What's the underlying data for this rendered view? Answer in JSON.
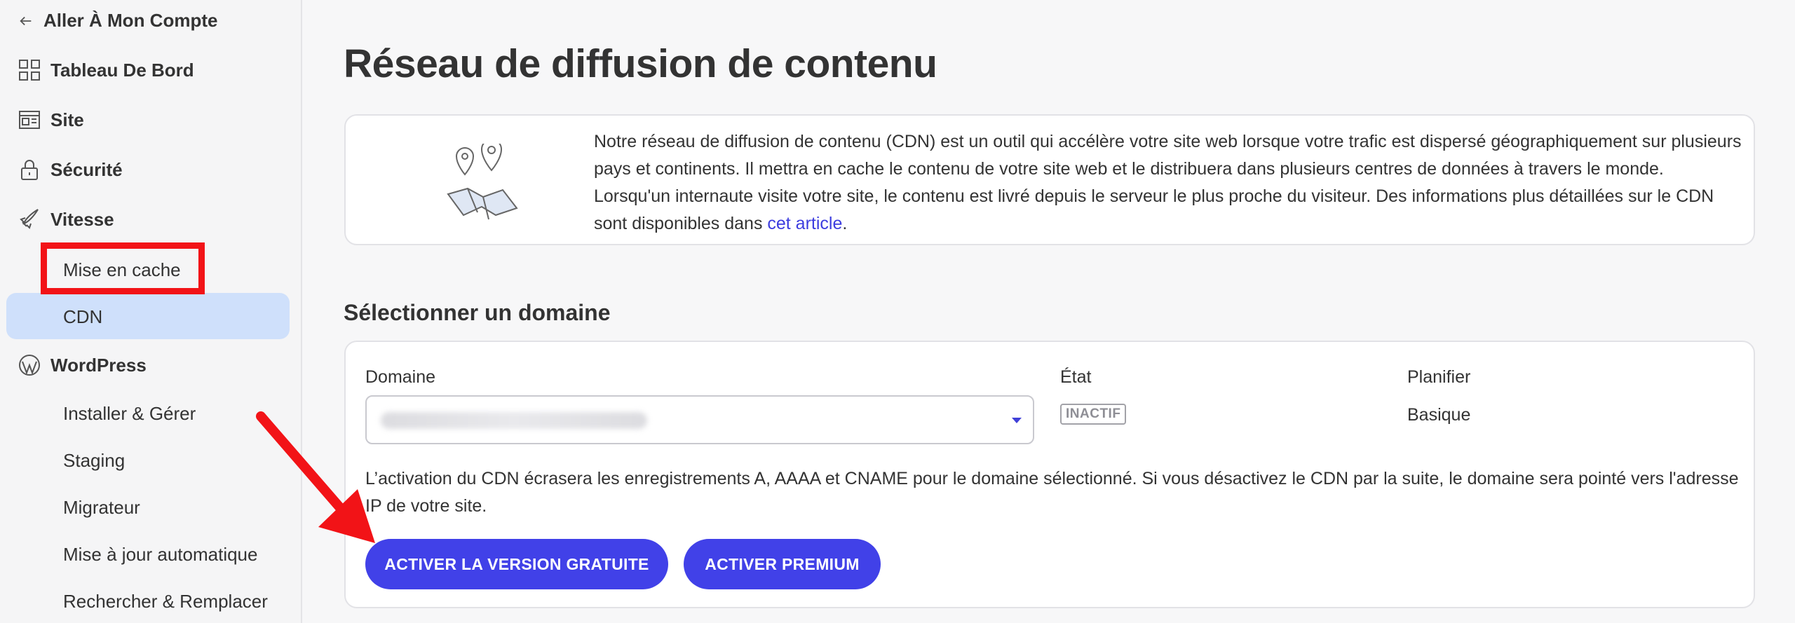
{
  "sidebar": {
    "back_label": "Aller À Mon Compte",
    "items": [
      {
        "label": "Tableau De Bord",
        "icon": "grid-icon"
      },
      {
        "label": "Site",
        "icon": "site-icon"
      },
      {
        "label": "Sécurité",
        "icon": "lock-icon"
      },
      {
        "label": "Vitesse",
        "icon": "rocket-icon"
      },
      {
        "label": "WordPress",
        "icon": "wordpress-icon"
      }
    ],
    "speed_sub": [
      "Mise en cache",
      "CDN"
    ],
    "wordpress_sub": [
      "Installer & Gérer",
      "Staging",
      "Migrateur",
      "Mise à jour automatique",
      "Rechercher & Remplacer"
    ],
    "active_item": "CDN"
  },
  "page": {
    "title": "Réseau de diffusion de contenu"
  },
  "info": {
    "text": "Notre réseau de diffusion de contenu (CDN) est un outil qui accélère votre site web lorsque votre trafic est dispersé géographiquement sur plusieurs pays et continents. Il mettra en cache le contenu de votre site web et le distribuera dans plusieurs centres de données à travers le monde. Lorsqu'un internaute visite votre site, le contenu est livré depuis le serveur le plus proche du visiteur. Des informations plus détaillées sur le CDN sont disponibles dans ",
    "link": "cet article",
    "after": ".",
    "illustration": "map-pins-icon"
  },
  "domain_section": {
    "title": "Sélectionner un domaine",
    "col_domain": "Domaine",
    "col_state": "État",
    "col_plan": "Planifier",
    "state_value": "INACTIF",
    "plan_value": "Basique",
    "warning": "L’activation du CDN écrasera les enregistrements A, AAAA et CNAME pour le domaine sélectionné. Si vous désactivez le CDN par la suite, le domaine sera pointé vers l'adresse IP de votre site.",
    "btn_free": "ACTIVER LA VERSION GRATUITE",
    "btn_premium": "ACTIVER PREMIUM"
  },
  "colors": {
    "accent": "#4141e8",
    "active_bg": "#cfe0fb",
    "annotation": "#f21317"
  }
}
